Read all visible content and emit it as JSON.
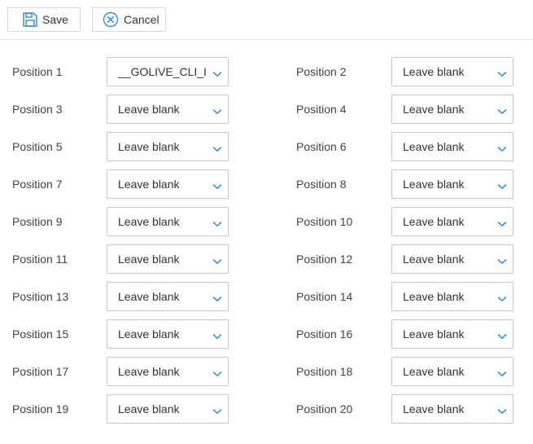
{
  "toolbar": {
    "save_label": "Save",
    "cancel_label": "Cancel",
    "accent": "#3a8fd6"
  },
  "positions": [
    {
      "label": "Position 1",
      "value": "__GOLIVE_CLI_IM"
    },
    {
      "label": "Position 2",
      "value": "Leave blank"
    },
    {
      "label": "Position 3",
      "value": "Leave blank"
    },
    {
      "label": "Position 4",
      "value": "Leave blank"
    },
    {
      "label": "Position 5",
      "value": "Leave blank"
    },
    {
      "label": "Position 6",
      "value": "Leave blank"
    },
    {
      "label": "Position 7",
      "value": "Leave blank"
    },
    {
      "label": "Position 8",
      "value": "Leave blank"
    },
    {
      "label": "Position 9",
      "value": "Leave blank"
    },
    {
      "label": "Position 10",
      "value": "Leave blank"
    },
    {
      "label": "Position 11",
      "value": "Leave blank"
    },
    {
      "label": "Position 12",
      "value": "Leave blank"
    },
    {
      "label": "Position 13",
      "value": "Leave blank"
    },
    {
      "label": "Position 14",
      "value": "Leave blank"
    },
    {
      "label": "Position 15",
      "value": "Leave blank"
    },
    {
      "label": "Position 16",
      "value": "Leave blank"
    },
    {
      "label": "Position 17",
      "value": "Leave blank"
    },
    {
      "label": "Position 18",
      "value": "Leave blank"
    },
    {
      "label": "Position 19",
      "value": "Leave blank"
    },
    {
      "label": "Position 20",
      "value": "Leave blank"
    }
  ]
}
